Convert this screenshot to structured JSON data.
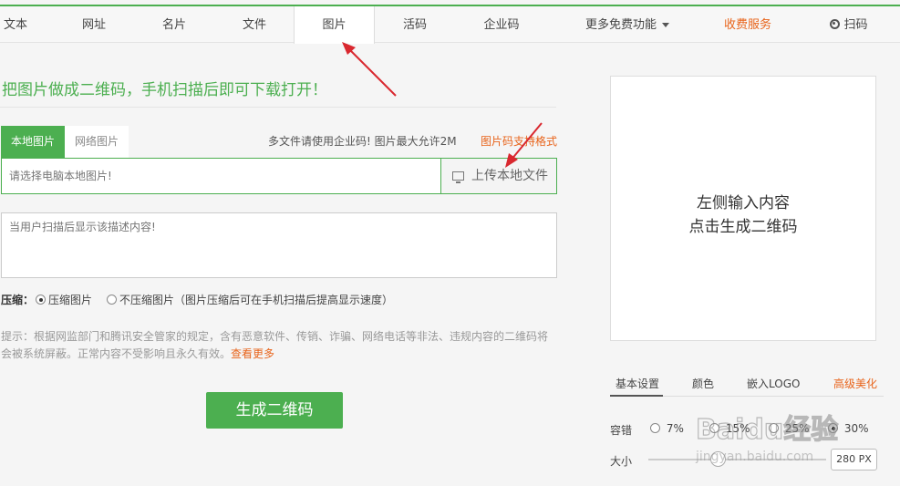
{
  "nav": {
    "items": [
      {
        "label": "文本"
      },
      {
        "label": "网址"
      },
      {
        "label": "名片"
      },
      {
        "label": "文件"
      },
      {
        "label": "图片"
      },
      {
        "label": "活码"
      },
      {
        "label": "企业码"
      },
      {
        "label": "更多免费功能"
      },
      {
        "label": "收费服务"
      },
      {
        "label": "扫码"
      }
    ],
    "active_index": 4,
    "accent_color": "#4caf50",
    "highlight_color": "#e8641b"
  },
  "main": {
    "headline": "把图片做成二维码，手机扫描后即可下载打开！",
    "tabs": [
      {
        "label": "本地图片"
      },
      {
        "label": "网络图片"
      }
    ],
    "note": "多文件请使用企业码!  图片最大允许2M",
    "note_link": "图片码支持格式",
    "file_placeholder": "请选择电脑本地图片!",
    "upload_label": "上传本地文件",
    "desc_placeholder": "当用户扫描后显示该描述内容!",
    "compress": {
      "label": "压缩：",
      "option_on": "压缩图片",
      "option_off": "不压缩图片（图片压缩后可在手机扫描后提高显示速度）",
      "selected": "压缩图片"
    },
    "tip": {
      "label": "提示：",
      "text": "根据网监部门和腾讯安全管家的规定，含有恶意软件、传销、诈骗、网络电话等非法、违规内容的二维码将会被系统屏蔽。正常内容不受影响且永久有效。",
      "more": "查看更多"
    },
    "generate_label": "生成二维码"
  },
  "preview": {
    "line1": "左侧输入内容",
    "line2": "点击生成二维码"
  },
  "settings": {
    "tabs": [
      {
        "label": "基本设置"
      },
      {
        "label": "颜色"
      },
      {
        "label": "嵌入LOGO"
      },
      {
        "label": "高级美化"
      }
    ],
    "ec_label": "容错",
    "ec_options": [
      {
        "label": "7%"
      },
      {
        "label": "15%"
      },
      {
        "label": "25%"
      },
      {
        "label": "30%"
      }
    ],
    "size_label": "大小",
    "size_value": "280 PX"
  },
  "watermark": {
    "text": "Baidu经验",
    "url": "jingyan.baidu.com"
  }
}
